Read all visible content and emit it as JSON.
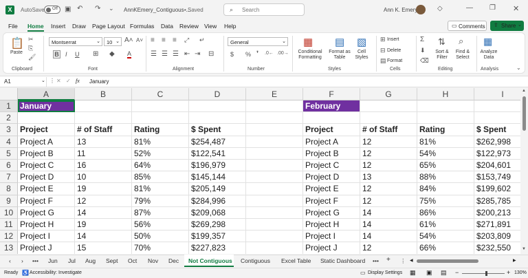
{
  "titlebar": {
    "autosave": "AutoSave",
    "toggle": "Off",
    "filename": "AnnKEmery_Contiguous-...",
    "saved": "• Saved",
    "search_placeholder": "Search",
    "user": "Ann K. Emery"
  },
  "menu": {
    "items": [
      "File",
      "Home",
      "Insert",
      "Draw",
      "Page Layout",
      "Formulas",
      "Data",
      "Review",
      "View",
      "Help"
    ],
    "comments": "Comments",
    "share": "Share"
  },
  "ribbon": {
    "paste": "Paste",
    "font_name": "Montserrat",
    "font_size": "10",
    "number_format": "General",
    "cond_format": "Conditional Formatting",
    "format_table": "Format as Table",
    "cell_styles": "Cell Styles",
    "insert": "Insert",
    "delete": "Delete",
    "format": "Format",
    "sort": "Sort & Filter",
    "find": "Find & Select",
    "analyze": "Analyze Data",
    "groups": [
      "Clipboard",
      "Font",
      "Alignment",
      "Number",
      "Styles",
      "Cells",
      "Editing",
      "Analysis"
    ]
  },
  "formula": {
    "cell_ref": "A1",
    "fx": "fx",
    "value": "January"
  },
  "grid": {
    "columns": [
      "A",
      "B",
      "C",
      "D",
      "E",
      "F",
      "G",
      "H",
      "I"
    ],
    "rows": [
      "1",
      "2",
      "3",
      "4",
      "5",
      "6",
      "7",
      "8",
      "9",
      "10",
      "11",
      "12",
      "13"
    ],
    "jan": {
      "title": "January",
      "headers": [
        "Project",
        "# of Staff",
        "Rating",
        "$ Spent"
      ],
      "data": [
        [
          "Project A",
          "13",
          "81%",
          "$254,487"
        ],
        [
          "Project B",
          "11",
          "52%",
          "$122,541"
        ],
        [
          "Project C",
          "16",
          "64%",
          "$196,979"
        ],
        [
          "Project D",
          "10",
          "85%",
          "$145,144"
        ],
        [
          "Project E",
          "19",
          "81%",
          "$205,149"
        ],
        [
          "Project F",
          "12",
          "79%",
          "$284,996"
        ],
        [
          "Project G",
          "14",
          "87%",
          "$209,068"
        ],
        [
          "Project H",
          "19",
          "56%",
          "$269,298"
        ],
        [
          "Project I",
          "14",
          "50%",
          "$199,357"
        ],
        [
          "Project J",
          "15",
          "70%",
          "$227,823"
        ]
      ]
    },
    "feb": {
      "title": "February",
      "headers": [
        "Project",
        "# of Staff",
        "Rating",
        "$ Spent"
      ],
      "data": [
        [
          "Project A",
          "12",
          "81%",
          "$262,998"
        ],
        [
          "Project B",
          "12",
          "54%",
          "$122,973"
        ],
        [
          "Project C",
          "12",
          "65%",
          "$204,601"
        ],
        [
          "Project D",
          "13",
          "88%",
          "$153,749"
        ],
        [
          "Project E",
          "12",
          "84%",
          "$199,602"
        ],
        [
          "Project F",
          "12",
          "75%",
          "$285,785"
        ],
        [
          "Project G",
          "14",
          "86%",
          "$200,213"
        ],
        [
          "Project H",
          "14",
          "61%",
          "$271,891"
        ],
        [
          "Project I",
          "14",
          "54%",
          "$203,809"
        ],
        [
          "Project J",
          "12",
          "66%",
          "$232,550"
        ]
      ]
    }
  },
  "sheets": {
    "tabs": [
      "Jun",
      "Jul",
      "Aug",
      "Sept",
      "Oct",
      "Nov",
      "Dec",
      "Not Contiguous",
      "Contiguous",
      "Excel Table",
      "Static Dashboard"
    ],
    "active": "Not Contiguous",
    "more": "•••"
  },
  "status": {
    "ready": "Ready",
    "accessibility": "Accessibility: Investigate",
    "display": "Display Settings",
    "zoom": "130%"
  },
  "colors": {
    "purple": "#7030a0",
    "green": "#107c41"
  }
}
